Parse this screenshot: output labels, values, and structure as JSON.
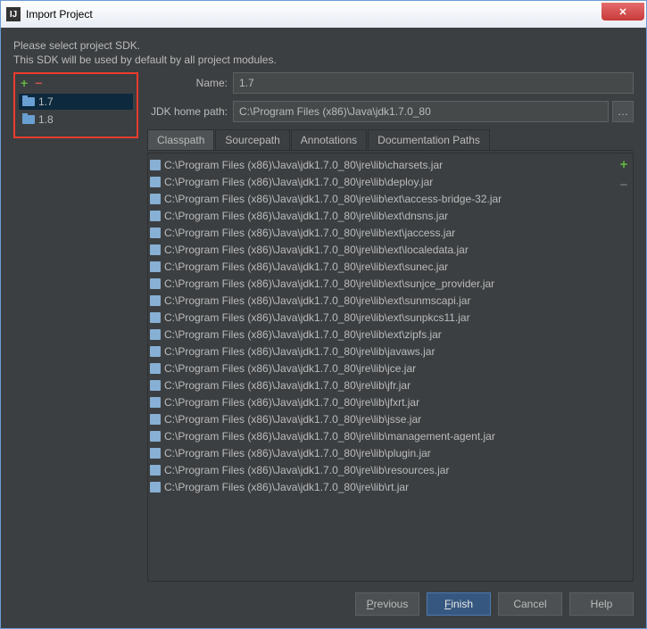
{
  "window": {
    "title": "Import Project"
  },
  "intro": {
    "line1": "Please select project SDK.",
    "line2": "This SDK will be used by default by all project modules."
  },
  "sdk_toolbar": {
    "add": "+",
    "remove": "−"
  },
  "sdk_list": [
    {
      "label": "1.7",
      "selected": true
    },
    {
      "label": "1.8",
      "selected": false
    }
  ],
  "fields": {
    "name_label": "Name:",
    "name_value": "1.7",
    "home_label": "JDK home path:",
    "home_value": "C:\\Program Files (x86)\\Java\\jdk1.7.0_80",
    "browse": "…"
  },
  "tabs": [
    {
      "label": "Classpath",
      "active": true
    },
    {
      "label": "Sourcepath",
      "active": false
    },
    {
      "label": "Annotations",
      "active": false
    },
    {
      "label": "Documentation Paths",
      "active": false
    }
  ],
  "classpath": [
    "C:\\Program Files (x86)\\Java\\jdk1.7.0_80\\jre\\lib\\charsets.jar",
    "C:\\Program Files (x86)\\Java\\jdk1.7.0_80\\jre\\lib\\deploy.jar",
    "C:\\Program Files (x86)\\Java\\jdk1.7.0_80\\jre\\lib\\ext\\access-bridge-32.jar",
    "C:\\Program Files (x86)\\Java\\jdk1.7.0_80\\jre\\lib\\ext\\dnsns.jar",
    "C:\\Program Files (x86)\\Java\\jdk1.7.0_80\\jre\\lib\\ext\\jaccess.jar",
    "C:\\Program Files (x86)\\Java\\jdk1.7.0_80\\jre\\lib\\ext\\localedata.jar",
    "C:\\Program Files (x86)\\Java\\jdk1.7.0_80\\jre\\lib\\ext\\sunec.jar",
    "C:\\Program Files (x86)\\Java\\jdk1.7.0_80\\jre\\lib\\ext\\sunjce_provider.jar",
    "C:\\Program Files (x86)\\Java\\jdk1.7.0_80\\jre\\lib\\ext\\sunmscapi.jar",
    "C:\\Program Files (x86)\\Java\\jdk1.7.0_80\\jre\\lib\\ext\\sunpkcs11.jar",
    "C:\\Program Files (x86)\\Java\\jdk1.7.0_80\\jre\\lib\\ext\\zipfs.jar",
    "C:\\Program Files (x86)\\Java\\jdk1.7.0_80\\jre\\lib\\javaws.jar",
    "C:\\Program Files (x86)\\Java\\jdk1.7.0_80\\jre\\lib\\jce.jar",
    "C:\\Program Files (x86)\\Java\\jdk1.7.0_80\\jre\\lib\\jfr.jar",
    "C:\\Program Files (x86)\\Java\\jdk1.7.0_80\\jre\\lib\\jfxrt.jar",
    "C:\\Program Files (x86)\\Java\\jdk1.7.0_80\\jre\\lib\\jsse.jar",
    "C:\\Program Files (x86)\\Java\\jdk1.7.0_80\\jre\\lib\\management-agent.jar",
    "C:\\Program Files (x86)\\Java\\jdk1.7.0_80\\jre\\lib\\plugin.jar",
    "C:\\Program Files (x86)\\Java\\jdk1.7.0_80\\jre\\lib\\resources.jar",
    "C:\\Program Files (x86)\\Java\\jdk1.7.0_80\\jre\\lib\\rt.jar"
  ],
  "list_side": {
    "add": "+",
    "remove": "−"
  },
  "footer": {
    "previous_mn": "P",
    "previous_rest": "revious",
    "finish_mn": "F",
    "finish_rest": "inish",
    "cancel": "Cancel",
    "help": "Help"
  }
}
